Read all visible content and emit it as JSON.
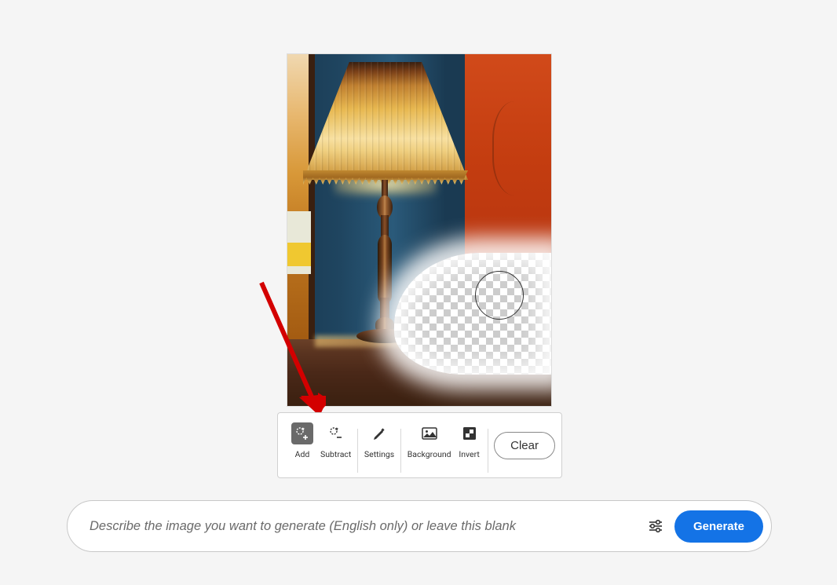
{
  "toolbar": {
    "tools": [
      {
        "label": "Add",
        "icon": "add-brush-icon",
        "active": true
      },
      {
        "label": "Subtract",
        "icon": "subtract-brush-icon",
        "active": false
      },
      {
        "label": "Settings",
        "icon": "brush-settings-icon",
        "active": false
      },
      {
        "label": "Background",
        "icon": "background-icon",
        "active": false
      },
      {
        "label": "Invert",
        "icon": "invert-icon",
        "active": false
      }
    ],
    "clear_label": "Clear"
  },
  "prompt": {
    "placeholder": "Describe the image you want to generate (English only) or leave this blank",
    "generate_label": "Generate"
  },
  "colors": {
    "accent": "#1473e6",
    "annotation": "#d30000"
  }
}
